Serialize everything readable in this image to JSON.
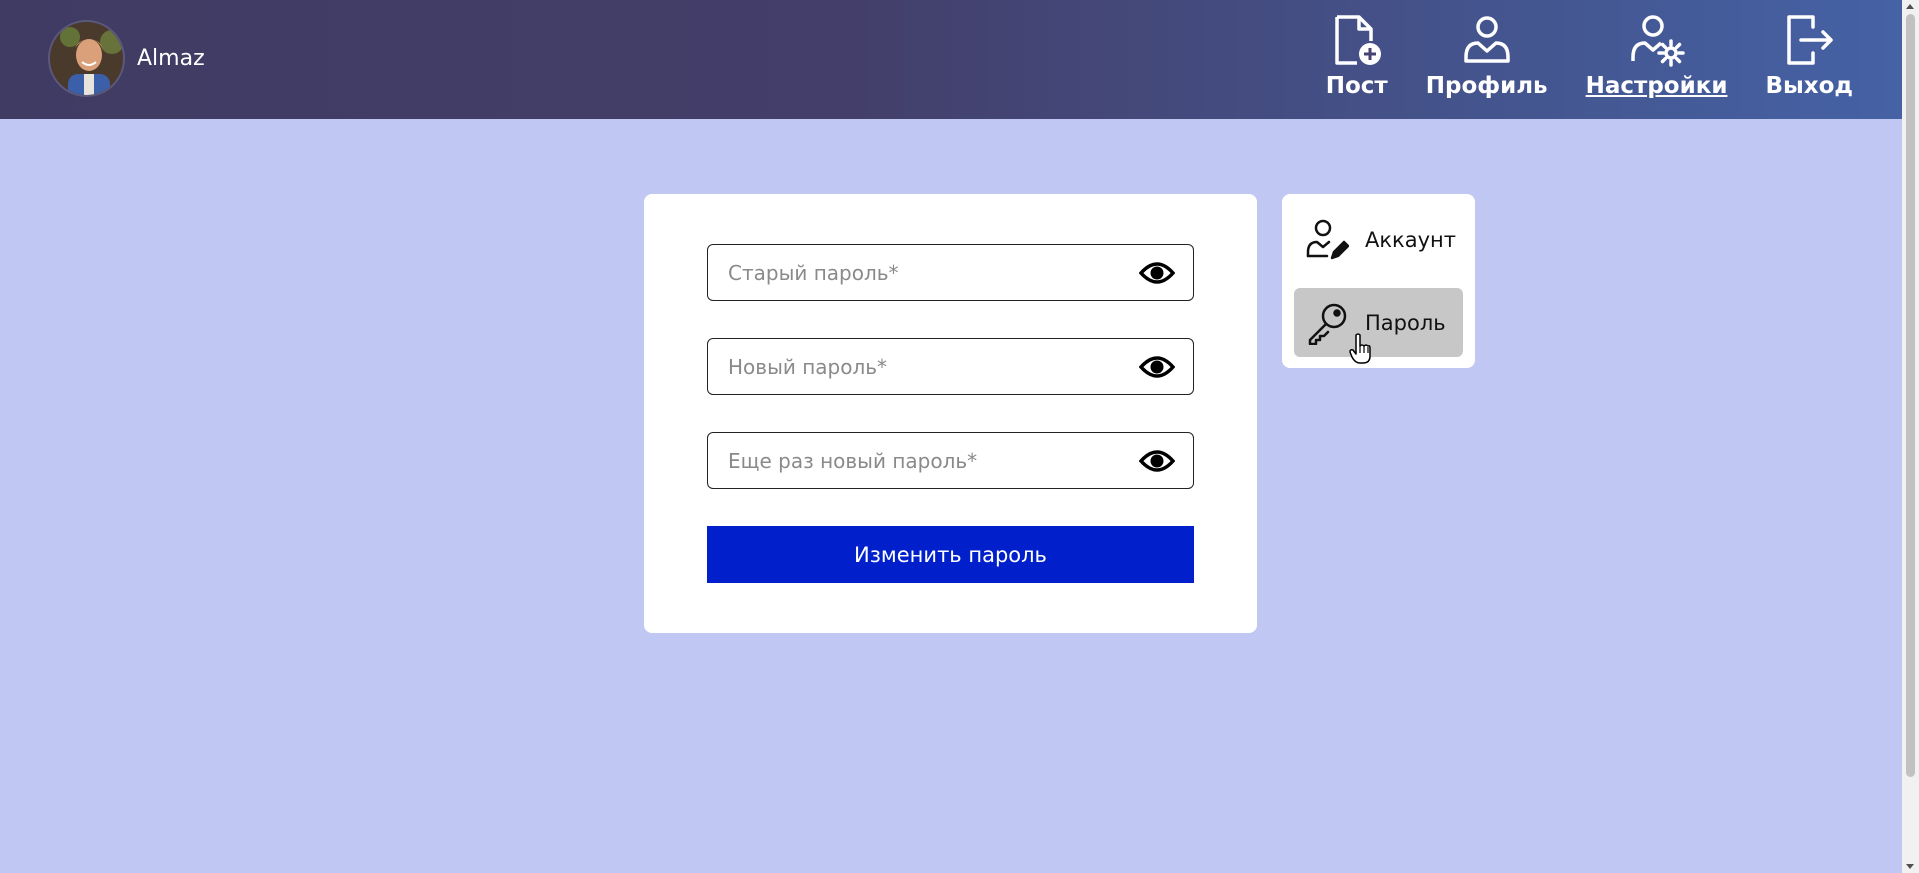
{
  "header": {
    "username": "Almaz",
    "nav": [
      {
        "label": "Пост",
        "icon": "file-plus-icon"
      },
      {
        "label": "Профиль",
        "icon": "user-icon"
      },
      {
        "label": "Настройки",
        "icon": "user-gear-icon",
        "active": true
      },
      {
        "label": "Выход",
        "icon": "logout-icon"
      }
    ]
  },
  "form": {
    "old_password_placeholder": "Старый пароль*",
    "new_password_placeholder": "Новый пароль*",
    "repeat_password_placeholder": "Еще раз новый пароль*",
    "submit_label": "Изменить пароль"
  },
  "side_menu": {
    "items": [
      {
        "label": "Аккаунт",
        "icon": "user-edit-icon"
      },
      {
        "label": "Пароль",
        "icon": "key-icon",
        "active": true
      }
    ]
  },
  "colors": {
    "page_bg": "#c0c7f2",
    "header_start": "#3f3b63",
    "header_end": "#4562a5",
    "button": "#0120cc",
    "active_side_item": "#c7c7c7"
  }
}
